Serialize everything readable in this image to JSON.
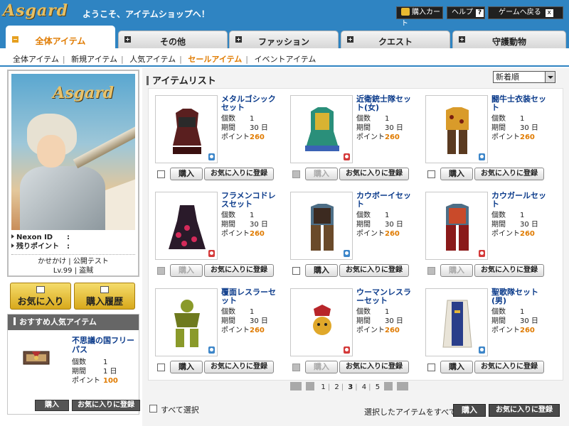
{
  "header": {
    "logo": "Asgard",
    "welcome": "ようこそ、アイテムショップへ！",
    "cart_label": "購入カート",
    "help_label": "ヘルプ",
    "help_glyph": "?",
    "back_label": "ゲームへ戻る",
    "back_glyph": "x"
  },
  "tabs": [
    {
      "label": "全体アイテム",
      "active": true
    },
    {
      "label": "その他"
    },
    {
      "label": "ファッション"
    },
    {
      "label": "クエスト"
    },
    {
      "label": "守護動物"
    }
  ],
  "subnav": [
    {
      "label": "全体アイテム"
    },
    {
      "label": "新規アイテム"
    },
    {
      "label": "人気アイテム"
    },
    {
      "label": "セールアイテム",
      "current": true
    },
    {
      "label": "イベントアイテム"
    }
  ],
  "profile": {
    "logo": "Asgard",
    "nexon_id_label": "Nexon ID",
    "nexon_id_sep": ":",
    "points_label": "残りポイント",
    "points_sep": ":",
    "status_line1": "かせかけ | 公開テスト",
    "status_line2": "Lv.99 | 盗賊"
  },
  "buttons": {
    "favorites": "お気に入り",
    "history": "購入履歴"
  },
  "reco": {
    "title": "おすすめ人気アイテム",
    "item": {
      "name": "不思議の国フリーパス",
      "qty_label": "個数",
      "qty": "1",
      "period_label": "期間",
      "period": "1 日",
      "point_label": "ポイント",
      "point": "100"
    },
    "buy": "購入",
    "fav": "お気に入りに登録"
  },
  "main": {
    "title": "アイテムリスト",
    "sort": "新着順"
  },
  "items": [
    {
      "name": "メタルゴシックセット",
      "qty": "1",
      "period": "30 日",
      "point": "260",
      "gender": "m",
      "disabled": false
    },
    {
      "name": "近衛銃士隊セット(女)",
      "qty": "1",
      "period": "30 日",
      "point": "260",
      "gender": "f",
      "disabled": true
    },
    {
      "name": "闘牛士衣装セット",
      "qty": "1",
      "period": "30 日",
      "point": "260",
      "gender": "m",
      "disabled": false
    },
    {
      "name": "フラメンコドレスセット",
      "qty": "1",
      "period": "30 日",
      "point": "260",
      "gender": "f",
      "disabled": true
    },
    {
      "name": "カウボーイセット",
      "qty": "1",
      "period": "30 日",
      "point": "260",
      "gender": "m",
      "disabled": false
    },
    {
      "name": "カウガールセット",
      "qty": "1",
      "period": "30 日",
      "point": "260",
      "gender": "f",
      "disabled": true
    },
    {
      "name": "覆面レスラーセット",
      "qty": "1",
      "period": "30 日",
      "point": "260",
      "gender": "m",
      "disabled": false
    },
    {
      "name": "ウーマンレスラーセット",
      "qty": "1",
      "period": "30 日",
      "point": "260",
      "gender": "f",
      "disabled": true
    },
    {
      "name": "聖歌隊セット(男)",
      "qty": "1",
      "period": "30 日",
      "point": "260",
      "gender": "m",
      "disabled": false
    }
  ],
  "labels": {
    "qty": "個数",
    "period": "期間",
    "point": "ポイント",
    "buy": "購入",
    "fav": "お気に入りに登録"
  },
  "pager": {
    "pages": [
      "1",
      "2",
      "3",
      "4",
      "5"
    ],
    "current": "3"
  },
  "footer": {
    "select_all": "すべて選択",
    "selected": "選択したアイテムをすべて",
    "buy": "購入",
    "fav": "お気に入りに登録"
  },
  "colors": {
    "header_blue": "#2f84c2",
    "accent_orange": "#e07b00",
    "item_name_blue": "#0a3a8a"
  }
}
